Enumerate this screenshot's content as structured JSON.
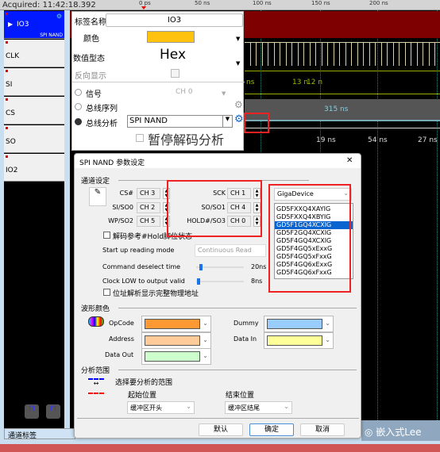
{
  "header": {
    "acquired": "Acquired: 11:42:18.392",
    "ticks": [
      "0 ps",
      "50 ns",
      "100 ns",
      "150 ns",
      "200 ns"
    ]
  },
  "channels": [
    {
      "label": "IO3",
      "sub": "SPI NAND"
    },
    {
      "label": "CLK"
    },
    {
      "label": "SI"
    },
    {
      "label": "CS"
    },
    {
      "label": "SO"
    },
    {
      "label": "IO2"
    }
  ],
  "bottom": {
    "channel_tag": "通道标签"
  },
  "waveform": {
    "si_labels": [
      "ns",
      "13 n",
      "12 n"
    ],
    "cs_label": "315 ns",
    "so_labels": [
      "19 ns",
      "54 ns",
      "27 ns"
    ],
    "io3_color": "#7f0000"
  },
  "panel": {
    "tag_name_label": "标签名称",
    "tag_name_value": "IO3",
    "color_label": "颜色",
    "color_value": "#ffc20e",
    "value_type_label": "数值型态",
    "value_type": "Hex",
    "invert_label": "反向显示",
    "signal_label": "信号",
    "signal_channel": "CH 0",
    "bus_seq_label": "总线序列",
    "bus_analysis_label": "总线分析",
    "bus_analysis_value": "SPI NAND",
    "pause_decode_label": "暂停解码分析"
  },
  "dialog": {
    "title": "SPI NAND 参数设定",
    "close": "✕",
    "channel_section": "通道设定",
    "pins": [
      {
        "label": "CS#",
        "value": "CH 3"
      },
      {
        "label": "SI/SO0",
        "value": "CH 2"
      },
      {
        "label": "WP/SO2",
        "value": "CH 5"
      },
      {
        "label": "SCK",
        "value": "CH 1"
      },
      {
        "label": "SO/SO1",
        "value": "CH 4"
      },
      {
        "label": "HOLD#/SO3",
        "value": "CH 0"
      }
    ],
    "hold_check": "解码参考#Hold脚位状态",
    "startup_label": "Start up reading mode",
    "startup_value": "Continuous Read",
    "deselect_label": "Command deselect time",
    "deselect_value": "20ns",
    "clklow_label": "Clock LOW to output valid",
    "clklow_value": "8ns",
    "addr_check": "位址解析显示完整物理地址",
    "vendor": "GigaDevice",
    "devices": [
      "GD5FXXQ4XAYIG",
      "GD5FXXQ4XBYIG",
      "GD5F1GQ4XCXIG",
      "GD5F2GQ4XCXIG",
      "GD5F4GQ4XCXIG",
      "GD5F4GQ5xExxG",
      "GD5F4GQ5xFxxG",
      "GD5F4GQ6xExxG",
      "GD5F4GQ6xFxxG"
    ],
    "selected_device": "GD5F1GQ4XCXIG",
    "color_section": "波形颜色",
    "colors": [
      {
        "label": "OpCode",
        "value": "#ff9933"
      },
      {
        "label": "Address",
        "value": "#ffcc99"
      },
      {
        "label": "Data Out",
        "value": "#ccffcc"
      },
      {
        "label": "Dummy",
        "value": "#99ccff"
      },
      {
        "label": "Data In",
        "value": "#ffff99"
      }
    ],
    "range_section": "分析范围",
    "range_desc": "选择要分析的范围",
    "start_label": "起始位置",
    "start_value": "缓冲区开头",
    "end_label": "结束位置",
    "end_value": "缓冲区结尾",
    "default_btn": "默认",
    "ok_btn": "确定",
    "cancel_btn": "取消"
  },
  "watermark": "嵌入式Lee"
}
